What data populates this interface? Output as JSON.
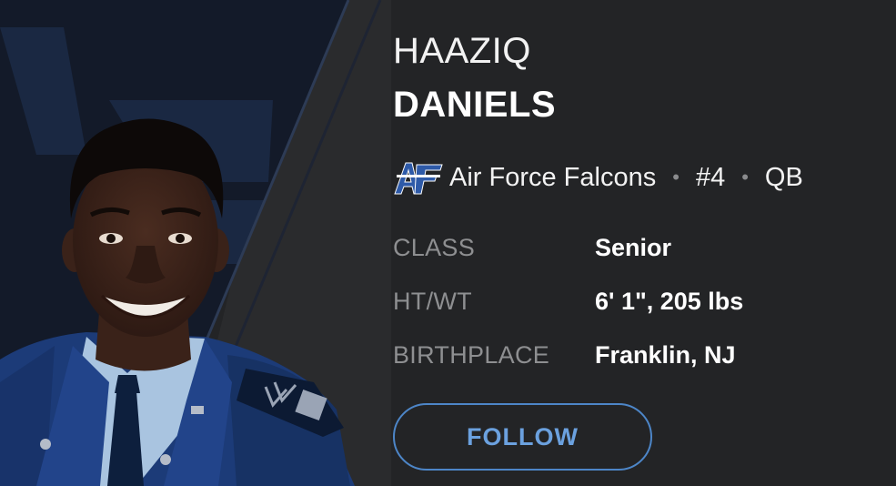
{
  "player": {
    "first_name": "HAAZIQ",
    "last_name": "DANIELS",
    "team": "Air Force Falcons",
    "number": "#4",
    "position": "QB",
    "separator": "•"
  },
  "details": [
    {
      "label": "CLASS",
      "value": "Senior"
    },
    {
      "label": "HT/WT",
      "value": "6' 1\", 205 lbs"
    },
    {
      "label": "BIRTHPLACE",
      "value": "Franklin, NJ"
    }
  ],
  "actions": {
    "follow_label": "FOLLOW"
  },
  "icons": {
    "team_logo": "air-force-af-logo-icon"
  },
  "colors": {
    "background": "#232426",
    "accent": "#4d86c8",
    "accent_text": "#6ba1df",
    "logo_blue": "#2e5aa8",
    "label_gray": "#8e8f91"
  }
}
